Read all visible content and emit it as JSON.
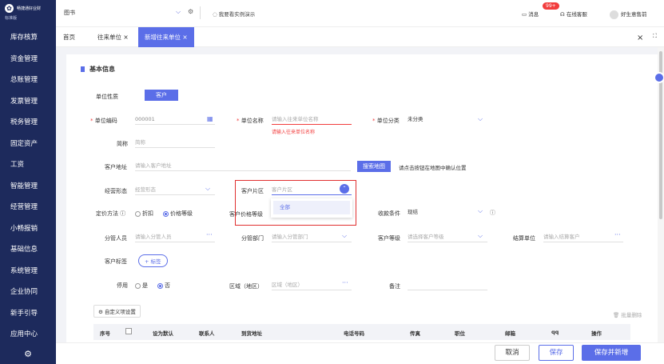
{
  "app": {
    "logo_name": "畅捷通好业财",
    "logo_edition": "标准版",
    "company": "图书",
    "demo_toggle": "我要看实例演示",
    "messages_label": "消息",
    "messages_badge": "99+",
    "service_label": "在线客服",
    "user_name": "好生意售前"
  },
  "sidebar": {
    "items": [
      {
        "label": "库存核算"
      },
      {
        "label": "资金管理"
      },
      {
        "label": "总账管理"
      },
      {
        "label": "发票管理"
      },
      {
        "label": "税务管理"
      },
      {
        "label": "固定资产"
      },
      {
        "label": "工资"
      },
      {
        "label": "智能管理"
      },
      {
        "label": "经营管理"
      },
      {
        "label": "小畅报销"
      },
      {
        "label": "基础信息"
      },
      {
        "label": "系统管理"
      },
      {
        "label": "企业协同"
      },
      {
        "label": "新手引导"
      },
      {
        "label": "应用中心"
      }
    ],
    "settings_icon": "gear-icon"
  },
  "tabs": {
    "home": "首页",
    "t1": "往来单位",
    "t2": "新增往来单位",
    "close": "×"
  },
  "form": {
    "section_title": "基本信息",
    "unit_nature_label": "单位性质",
    "unit_nature_value": "客户",
    "code_label": "单位编码",
    "code_value": "000001",
    "name_label": "单位名称",
    "name_placeholder": "请输入往来单位名称",
    "name_error": "请输入往来单位名称",
    "category_label": "单位分类",
    "category_value": "未分类",
    "short_label": "简称",
    "short_placeholder": "简称",
    "address_label": "客户地址",
    "address_placeholder": "请输入客户地址",
    "map_button": "搜索地图",
    "map_hint": "请点击按钮在地图中确认位置",
    "biz_form_label": "经营形态",
    "biz_form_placeholder": "经营形态",
    "region_label": "客户片区",
    "region_placeholder": "客户片区",
    "region_option": "全部",
    "pricing_label": "定价方法",
    "pricing_opt1": "折扣",
    "pricing_opt2": "价格等级",
    "price_level_label": "客户价格等级",
    "collect_label": "收款条件",
    "collect_value": "现结",
    "manager_label": "分管人员",
    "manager_placeholder": "请输入分管人员",
    "dept_label": "分管部门",
    "dept_placeholder": "请输入分管部门",
    "grade_label": "客户等级",
    "grade_placeholder": "请选择客户等级",
    "settle_label": "结算单位",
    "settle_placeholder": "请输入结算客户",
    "tag_label": "客户标签",
    "tag_button": "+ 标签",
    "disabled_label": "停用",
    "disabled_yes": "是",
    "disabled_no": "否",
    "area_label": "区域（地区）",
    "area_placeholder": "区域（地区）",
    "note_label": "备注",
    "custom_button": "自定义项设置",
    "batch_delete": "批量删除"
  },
  "table": {
    "headers": [
      "序号",
      "",
      "设为默认",
      "联系人",
      "到货地址",
      "电话号码",
      "传真",
      "职位",
      "邮箱",
      "qq",
      "操作"
    ]
  },
  "footer": {
    "cancel": "取消",
    "save": "保存",
    "save_new": "保存并新增"
  }
}
